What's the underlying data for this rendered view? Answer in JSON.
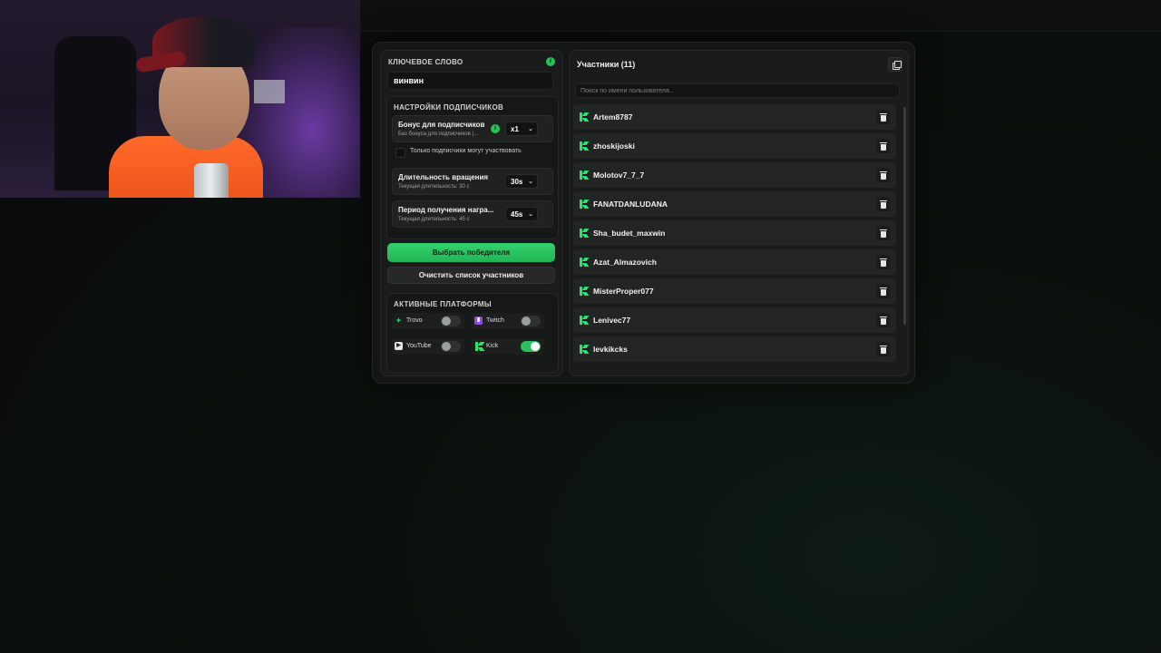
{
  "keyword": {
    "label": "КЛЮЧЕВОЕ СЛОВО",
    "value": "винвин",
    "info": "i"
  },
  "subscriber_settings": {
    "title": "НАСТРОЙКИ ПОДПИСЧИКОВ",
    "bonus": {
      "title": "Бонус для подписчиков",
      "subtitle": "Без бонуса для подписчиков (...",
      "value": "x1",
      "info": "i"
    },
    "only_subs": {
      "label": "Только подписчики могут участвовать",
      "checked": false
    },
    "spin_duration": {
      "title": "Длительность вращения",
      "subtitle": "Текущая длительность: 30 с",
      "value": "30s"
    },
    "reward_period": {
      "title": "Период получения награ...",
      "subtitle": "Текущая длительность: 45 с",
      "value": "45s"
    }
  },
  "buttons": {
    "pick_winner": "Выбрать победителя",
    "clear_list": "Очистить список участников"
  },
  "platforms": {
    "title": "АКТИВНЫЕ ПЛАТФОРМЫ",
    "items": [
      {
        "name": "Trovo",
        "icon": "trovo-icon",
        "enabled": false,
        "color": "#1fc77f"
      },
      {
        "name": "Twitch",
        "icon": "twitch-icon",
        "enabled": false,
        "color": "#9146ff"
      },
      {
        "name": "YouTube",
        "icon": "youtube-icon",
        "enabled": false,
        "color": "#e6e6e6"
      },
      {
        "name": "Kick",
        "icon": "kick-icon",
        "enabled": true,
        "color": "#2de36b"
      }
    ]
  },
  "participants": {
    "title": "Участники (11)",
    "search_placeholder": "Поиск по имени пользователя...",
    "items": [
      "Artem8787",
      "zhoskijoski",
      "Molotov7_7_7",
      "FANATDANLUDANA",
      "Sha_budet_maxwin",
      "Azat_Almazovich",
      "MisterProper077",
      "Lenivec77",
      "levkikcks"
    ]
  },
  "colors": {
    "accent": "#2bbf5e",
    "kick": "#2de36b",
    "panel": "#1a1c1b"
  }
}
